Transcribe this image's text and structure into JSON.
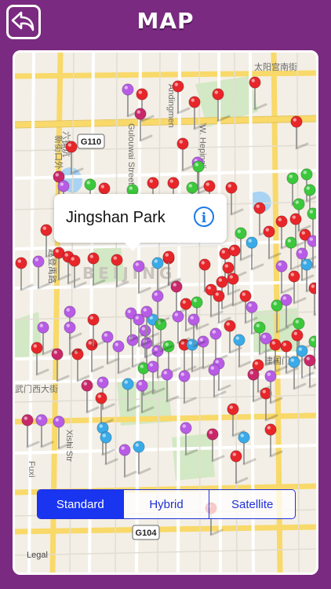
{
  "header": {
    "title": "MAP"
  },
  "map": {
    "city_label": "BEIJING",
    "road_labels": {
      "g110": "G110",
      "g104": "G104",
      "xinjiekou": "新街口外",
      "gulouwai": "Gulouwai Street",
      "andingmen": "Andingmen",
      "hepingli": "W. Hepingli",
      "taiyanggong": "太阳宫南街",
      "zhaodeng": "赵登禹路",
      "fuchengmen": "武门西大街",
      "jianguomen": "建国门",
      "fuxing": "Fuxi",
      "liubushang": "六铺炕",
      "xishi": "Xishi Str"
    },
    "callout": {
      "name": "Jingshan Park",
      "info_icon": "info-icon"
    },
    "pin_colors": {
      "red": "#e8262a",
      "purple": "#b85ce6",
      "green": "#3cc83c",
      "blue": "#3aaae8",
      "magenta": "#c8286a"
    },
    "legal": "Legal"
  },
  "map_type": {
    "options": [
      "Standard",
      "Hybrid",
      "Satellite"
    ],
    "selected": "Standard"
  },
  "icons": {
    "back": "back-arrow-icon"
  }
}
